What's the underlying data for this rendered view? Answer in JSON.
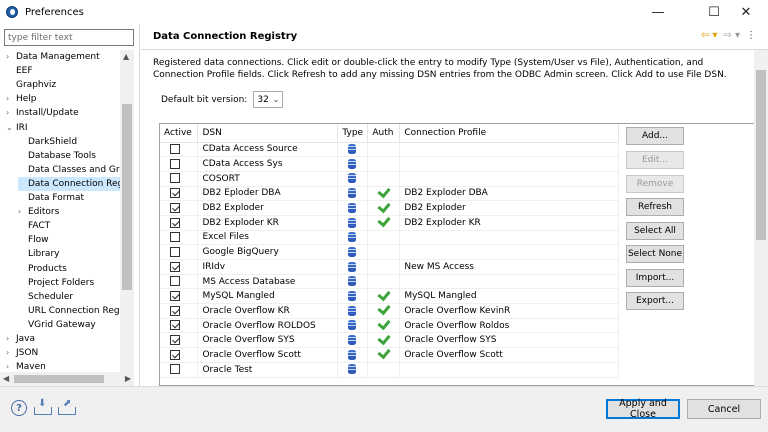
{
  "window": {
    "title": "Preferences",
    "minimize": "—",
    "maximize": "☐",
    "close": "✕"
  },
  "sidebar": {
    "filter_placeholder": "type filter text",
    "items": [
      {
        "label": "Data Management",
        "twisty": "›",
        "indent": 0
      },
      {
        "label": "EEF",
        "twisty": "",
        "indent": 0
      },
      {
        "label": "Graphviz",
        "twisty": "",
        "indent": 0
      },
      {
        "label": "Help",
        "twisty": "›",
        "indent": 0
      },
      {
        "label": "Install/Update",
        "twisty": "›",
        "indent": 0
      },
      {
        "label": "IRI",
        "twisty": "⌄",
        "indent": 0
      },
      {
        "label": "DarkShield",
        "twisty": "",
        "indent": 1
      },
      {
        "label": "Database Tools",
        "twisty": "",
        "indent": 1
      },
      {
        "label": "Data Classes and Grou",
        "twisty": "",
        "indent": 1
      },
      {
        "label": "Data Connection Reg",
        "twisty": "",
        "indent": 1,
        "selected": true
      },
      {
        "label": "Data Format",
        "twisty": "",
        "indent": 1
      },
      {
        "label": "Editors",
        "twisty": "›",
        "indent": 1
      },
      {
        "label": "FACT",
        "twisty": "",
        "indent": 1
      },
      {
        "label": "Flow",
        "twisty": "",
        "indent": 1
      },
      {
        "label": "Library",
        "twisty": "",
        "indent": 1
      },
      {
        "label": "Products",
        "twisty": "",
        "indent": 1
      },
      {
        "label": "Project Folders",
        "twisty": "",
        "indent": 1
      },
      {
        "label": "Scheduler",
        "twisty": "",
        "indent": 1
      },
      {
        "label": "URL Connection Regi",
        "twisty": "",
        "indent": 1
      },
      {
        "label": "VGrid Gateway",
        "twisty": "",
        "indent": 1
      },
      {
        "label": "Java",
        "twisty": "›",
        "indent": 0
      },
      {
        "label": "JSON",
        "twisty": "›",
        "indent": 0
      },
      {
        "label": "Maven",
        "twisty": "›",
        "indent": 0
      }
    ]
  },
  "main": {
    "title": "Data Connection Registry",
    "description": "Registered data connections. Click edit or double-click the entry to modify Type (System/User vs File), Authentication, and Connection Profile fields. Click Refresh to add any missing DSN entries from the ODBC Admin screen. Click Add to use File DSN.",
    "bit_label": "Default bit version:",
    "bit_value": "32",
    "columns": [
      "Active",
      "DSN",
      "Type",
      "Auth",
      "Connection Profile"
    ],
    "rows": [
      {
        "active": false,
        "dsn": "CData Access Source",
        "auth": false,
        "profile": ""
      },
      {
        "active": false,
        "dsn": "CData Access Sys",
        "auth": false,
        "profile": ""
      },
      {
        "active": false,
        "dsn": "COSORT",
        "auth": false,
        "profile": ""
      },
      {
        "active": true,
        "dsn": "DB2 Eploder DBA",
        "auth": true,
        "profile": "DB2 Exploder DBA"
      },
      {
        "active": true,
        "dsn": "DB2 Exploder",
        "auth": true,
        "profile": "DB2 Exploder"
      },
      {
        "active": true,
        "dsn": "DB2 Exploder KR",
        "auth": true,
        "profile": "DB2 Exploder KR"
      },
      {
        "active": false,
        "dsn": "Excel Files",
        "auth": false,
        "profile": ""
      },
      {
        "active": false,
        "dsn": "Google BigQuery",
        "auth": false,
        "profile": ""
      },
      {
        "active": true,
        "dsn": "IRIdv",
        "auth": false,
        "profile": "New MS Access"
      },
      {
        "active": false,
        "dsn": "MS Access Database",
        "auth": false,
        "profile": ""
      },
      {
        "active": true,
        "dsn": "MySQL Mangled",
        "auth": true,
        "profile": "MySQL Mangled"
      },
      {
        "active": true,
        "dsn": "Oracle Overflow KR",
        "auth": true,
        "profile": "Oracle Overflow KevinR"
      },
      {
        "active": true,
        "dsn": "Oracle Overflow ROLDOS",
        "auth": true,
        "profile": "Oracle Overflow Roldos"
      },
      {
        "active": true,
        "dsn": "Oracle Overflow SYS",
        "auth": true,
        "profile": "Oracle Overflow SYS"
      },
      {
        "active": true,
        "dsn": "Oracle Overflow Scott",
        "auth": true,
        "profile": "Oracle Overflow Scott"
      },
      {
        "active": false,
        "dsn": "Oracle Test",
        "auth": false,
        "profile": ""
      }
    ],
    "buttons": [
      {
        "label": "Add...",
        "disabled": false,
        "name": "add-button"
      },
      {
        "label": "Edit...",
        "disabled": true,
        "name": "edit-button"
      },
      {
        "label": "Remove",
        "disabled": true,
        "name": "remove-button"
      },
      {
        "label": "Refresh",
        "disabled": false,
        "name": "refresh-button"
      },
      {
        "label": "Select All",
        "disabled": false,
        "name": "select-all-button"
      },
      {
        "label": "Select None",
        "disabled": false,
        "name": "select-none-button"
      },
      {
        "label": "Import...",
        "disabled": false,
        "name": "import-button"
      },
      {
        "label": "Export...",
        "disabled": false,
        "name": "export-button"
      }
    ]
  },
  "footer": {
    "help": "?",
    "apply_close": "Apply and Close",
    "cancel": "Cancel"
  }
}
